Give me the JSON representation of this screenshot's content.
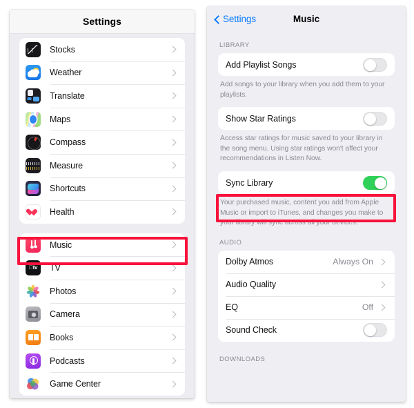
{
  "left_panel": {
    "header_title": "Settings",
    "groups": [
      {
        "items": [
          {
            "label": "Stocks",
            "icon": "stocks-app-icon"
          },
          {
            "label": "Weather",
            "icon": "weather-app-icon"
          },
          {
            "label": "Translate",
            "icon": "translate-app-icon"
          },
          {
            "label": "Maps",
            "icon": "maps-app-icon"
          },
          {
            "label": "Compass",
            "icon": "compass-app-icon"
          },
          {
            "label": "Measure",
            "icon": "measure-app-icon"
          },
          {
            "label": "Shortcuts",
            "icon": "shortcuts-app-icon"
          },
          {
            "label": "Health",
            "icon": "health-app-icon"
          }
        ]
      },
      {
        "items": [
          {
            "label": "Music",
            "icon": "music-app-icon",
            "highlighted": true
          },
          {
            "label": "TV",
            "icon": "tv-app-icon"
          },
          {
            "label": "Photos",
            "icon": "photos-app-icon"
          },
          {
            "label": "Camera",
            "icon": "camera-app-icon"
          },
          {
            "label": "Books",
            "icon": "books-app-icon"
          },
          {
            "label": "Podcasts",
            "icon": "podcasts-app-icon"
          },
          {
            "label": "Game Center",
            "icon": "game-center-app-icon"
          }
        ]
      }
    ]
  },
  "right_panel": {
    "back_label": "Settings",
    "title": "Music",
    "sections": [
      {
        "header": "LIBRARY",
        "rows": [
          {
            "label": "Add Playlist Songs",
            "control": "toggle",
            "toggle_on": false
          },
          {
            "label": "Show Star Ratings",
            "control": "toggle",
            "toggle_on": false
          }
        ]
      },
      {
        "header": "AUDIO",
        "rows": [
          {
            "label": "Dolby Atmos",
            "control": "chevron",
            "value": "Always On"
          },
          {
            "label": "Audio Quality",
            "control": "chevron",
            "value": ""
          },
          {
            "label": "EQ",
            "control": "chevron",
            "value": "Off"
          },
          {
            "label": "Sound Check",
            "control": "toggle",
            "toggle_on": false
          }
        ]
      },
      {
        "header": "DOWNLOADS",
        "rows": []
      }
    ],
    "footnotes": {
      "add_playlist_songs": "Add songs to your library when you add them to your playlists.",
      "show_star_ratings": "Access star ratings for music saved to your library in the song menu. Using star ratings won't affect your recommendations in Listen Now.",
      "sync_library": "Your purchased music, content you add from Apple Music or import to iTunes, and changes you make to your library will sync across all your devices."
    },
    "sync_library": {
      "label": "Sync Library",
      "toggle_on": true,
      "highlighted": true
    }
  },
  "colors": {
    "highlight_red": "#f8123c",
    "toggle_on_green": "#30d158",
    "link_blue": "#0a7cff",
    "panel_bg": "#eeeef3",
    "card_white": "#ffffff",
    "secondary_text": "#8b8b94"
  }
}
